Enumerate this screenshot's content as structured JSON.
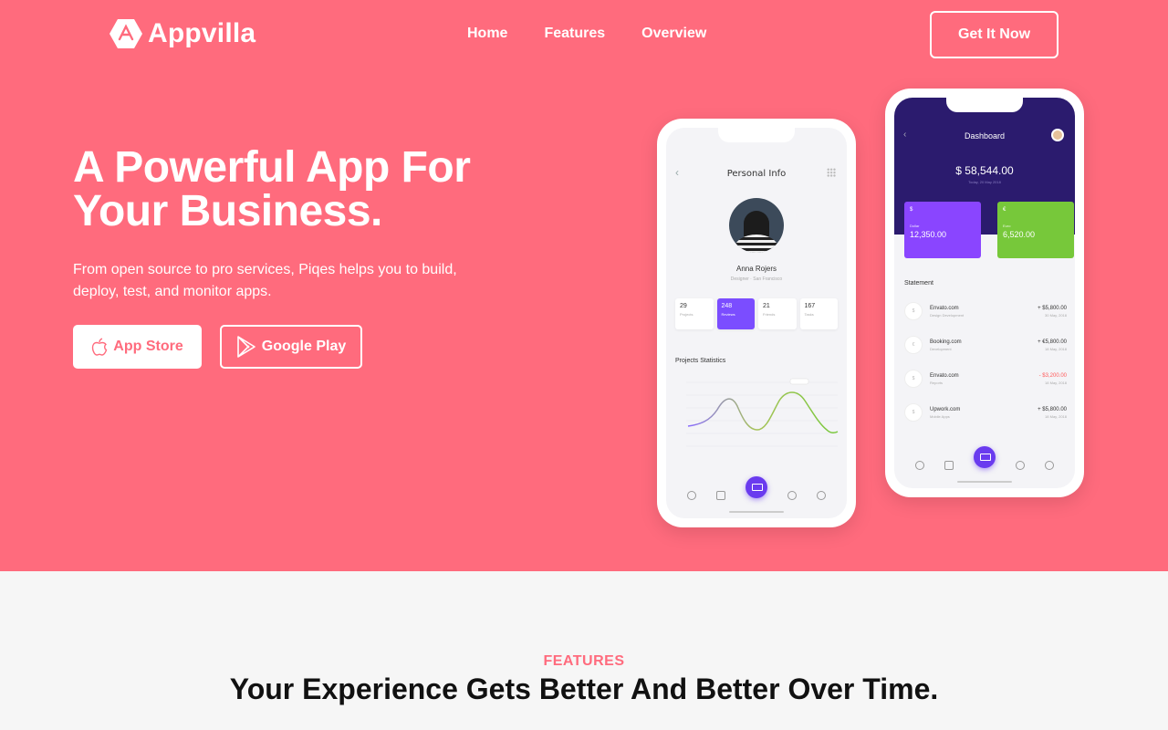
{
  "header": {
    "brand": "Appvilla",
    "nav": [
      "Home",
      "Features",
      "Overview"
    ],
    "cta": "Get It Now"
  },
  "hero": {
    "headline": "A Powerful App For Your Business.",
    "subtext": "From open source to pro services, Piqes helps you to build, deploy, test, and monitor apps.",
    "app_store": "App Store",
    "google_play": "Google Play"
  },
  "phone_profile": {
    "title": "Personal Info",
    "name": "Anna Rojers",
    "role": "Designer · San Francisco",
    "stats": [
      {
        "value": "29",
        "label": "Projects"
      },
      {
        "value": "248",
        "label": "Reviews"
      },
      {
        "value": "21",
        "label": "Friends"
      },
      {
        "value": "167",
        "label": "Tasks"
      }
    ],
    "chart_title": "Projects Statistics"
  },
  "phone_dashboard": {
    "title": "Dashboard",
    "balance": "$ 58,544.00",
    "balance_date": "Today, 20 May 2018",
    "cards": [
      {
        "symbol": "$",
        "label": "Dollar",
        "value": "12,350.00"
      },
      {
        "symbol": "€",
        "label": "Euro",
        "value": "6,520.00"
      }
    ],
    "statement_title": "Statement",
    "statement": [
      {
        "icon": "$",
        "name": "Envato.com",
        "sub": "Design Development",
        "amount": "+ $5,800.00",
        "date": "30 May, 2018",
        "negative": false
      },
      {
        "icon": "€",
        "name": "Booking.com",
        "sub": "Development",
        "amount": "+ €5,800.00",
        "date": "18 May, 2018",
        "negative": false
      },
      {
        "icon": "$",
        "name": "Envato.com",
        "sub": "Reports",
        "amount": "- $3,200.00",
        "date": "18 May, 2018",
        "negative": true
      },
      {
        "icon": "$",
        "name": "Upwork.com",
        "sub": "Mobile Apps",
        "amount": "+ $5,800.00",
        "date": "18 May, 2018",
        "negative": false
      }
    ]
  },
  "features": {
    "label": "FEATURES",
    "title": "Your Experience Gets Better And Better Over Time."
  },
  "colors": {
    "brand": "#ff6b7d",
    "purple": "#6a3bef",
    "green": "#77c83a",
    "navy": "#2b1b6e"
  }
}
